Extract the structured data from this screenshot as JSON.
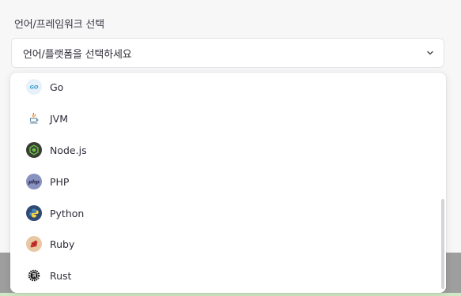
{
  "field": {
    "label": "언어/프레임워크 선택",
    "placeholder": "언어/플랫폼을 선택하세요"
  },
  "options": [
    {
      "label": "Go",
      "icon": "go-icon"
    },
    {
      "label": "JVM",
      "icon": "java-icon"
    },
    {
      "label": "Node.js",
      "icon": "nodejs-icon"
    },
    {
      "label": "PHP",
      "icon": "php-icon"
    },
    {
      "label": "Python",
      "icon": "python-icon"
    },
    {
      "label": "Ruby",
      "icon": "ruby-icon"
    },
    {
      "label": "Rust",
      "icon": "rust-icon"
    }
  ],
  "icon_text": {
    "go": "GO",
    "php": "php"
  }
}
